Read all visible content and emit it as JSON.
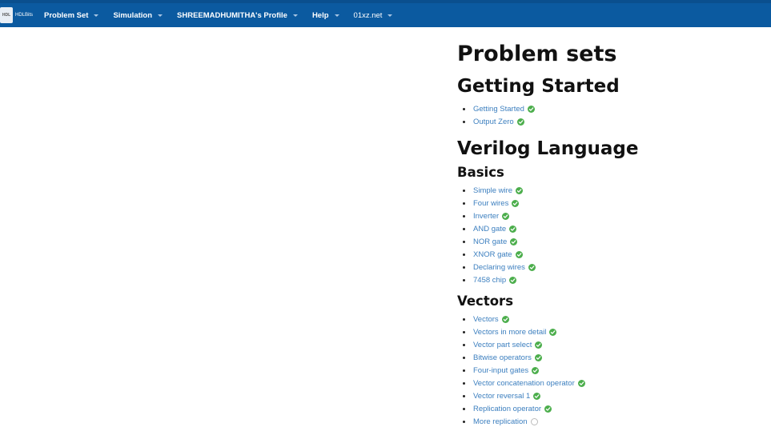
{
  "navbar": {
    "logo_small": "HDL",
    "logo_text": "HDLBits",
    "items": [
      {
        "label": "Problem Set",
        "bold": true
      },
      {
        "label": "Simulation",
        "bold": true
      },
      {
        "label": "SHREEMADHUMITHA's Profile",
        "bold": true
      },
      {
        "label": "Help",
        "bold": true
      },
      {
        "label": "01xz.net",
        "bold": false
      }
    ]
  },
  "main": {
    "title": "Problem sets",
    "sections": [
      {
        "heading": "Getting Started",
        "items": [
          {
            "label": "Getting Started",
            "done": true
          },
          {
            "label": "Output Zero",
            "done": true
          }
        ]
      }
    ],
    "verilog": {
      "heading": "Verilog Language",
      "basics": {
        "heading": "Basics",
        "items": [
          {
            "label": "Simple wire",
            "done": true
          },
          {
            "label": "Four wires",
            "done": true
          },
          {
            "label": "Inverter",
            "done": true
          },
          {
            "label": "AND gate",
            "done": true
          },
          {
            "label": "NOR gate",
            "done": true
          },
          {
            "label": "XNOR gate",
            "done": true
          },
          {
            "label": "Declaring wires",
            "done": true
          },
          {
            "label": "7458 chip",
            "done": true
          }
        ]
      },
      "vectors": {
        "heading": "Vectors",
        "items": [
          {
            "label": "Vectors",
            "done": true
          },
          {
            "label": "Vectors in more detail",
            "done": true
          },
          {
            "label": "Vector part select",
            "done": true
          },
          {
            "label": "Bitwise operators",
            "done": true
          },
          {
            "label": "Four-input gates",
            "done": true
          },
          {
            "label": "Vector concatenation operator",
            "done": true
          },
          {
            "label": "Vector reversal 1",
            "done": true
          },
          {
            "label": "Replication operator",
            "done": true
          },
          {
            "label": "More replication",
            "done": false
          }
        ]
      }
    },
    "colors": {
      "navbar": "#0b5aa0",
      "link": "#3c7fbf",
      "check": "#4cae4c"
    }
  }
}
